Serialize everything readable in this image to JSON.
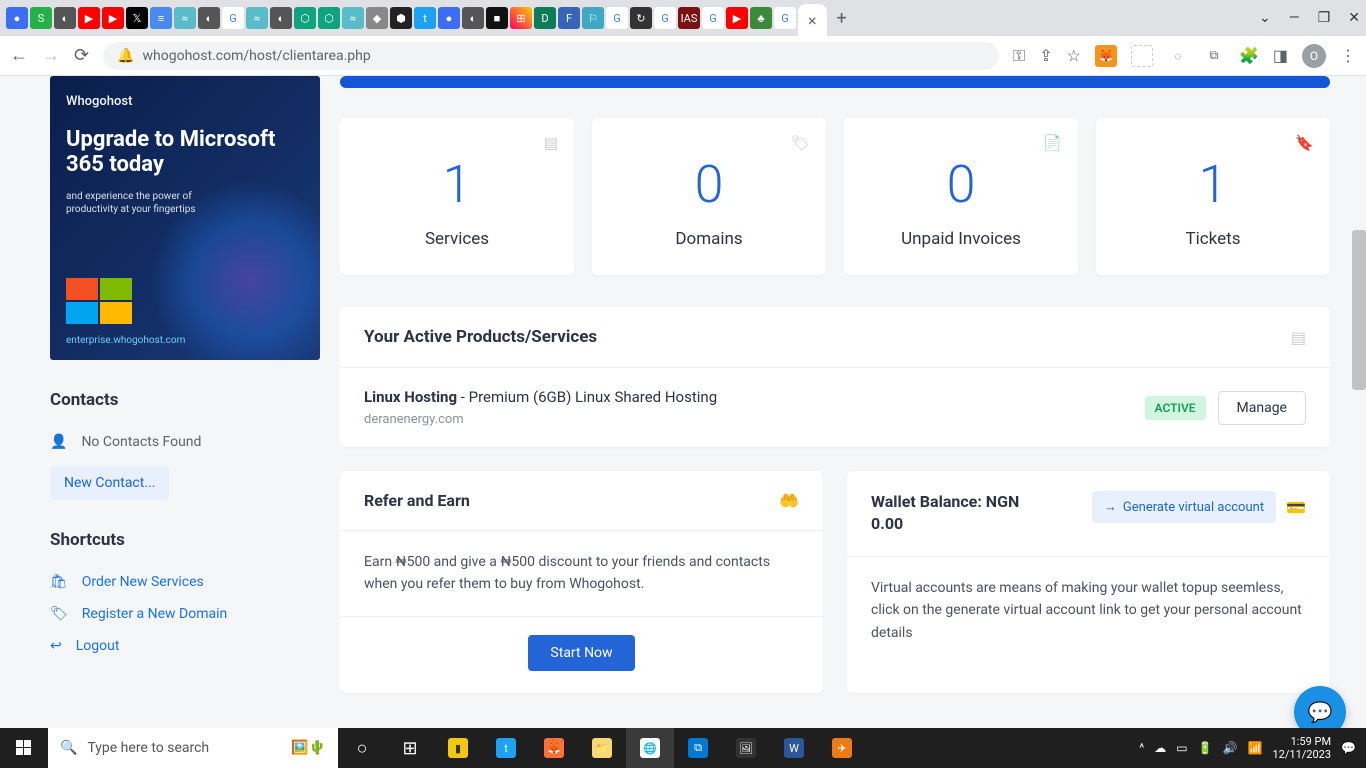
{
  "browser": {
    "url": "whogohost.com/host/clientarea.php",
    "avatar": "O"
  },
  "promo": {
    "brand": "Whogohost",
    "title": "Upgrade to Microsoft 365 today",
    "subtitle": "and experience the power of productivity at your fingertips",
    "link": "enterprise.whogohost.com"
  },
  "sidebar": {
    "contacts_title": "Contacts",
    "no_contacts": "No Contacts Found",
    "new_contact": "New Contact...",
    "shortcuts_title": "Shortcuts",
    "order": "Order New Services",
    "register_domain": "Register a New Domain",
    "logout": "Logout"
  },
  "stats": {
    "services": {
      "value": "1",
      "label": "Services"
    },
    "domains": {
      "value": "0",
      "label": "Domains"
    },
    "invoices": {
      "value": "0",
      "label": "Unpaid Invoices"
    },
    "tickets": {
      "value": "1",
      "label": "Tickets"
    }
  },
  "active_products": {
    "title": "Your Active Products/Services",
    "product_name": "Linux Hosting",
    "product_plan": " - Premium (6GB) Linux Shared Hosting",
    "product_domain": "deranenergy.com",
    "status": "ACTIVE",
    "manage": "Manage"
  },
  "refer": {
    "title": "Refer and Earn",
    "text": "Earn ₦500 and give a ₦500 discount to your friends and contacts when you refer them to buy from Whogohost.",
    "button": "Start Now"
  },
  "wallet": {
    "title": "Wallet Balance: NGN 0.00",
    "gen_button": "Generate virtual account",
    "text": "Virtual accounts are means of making your wallet topup seemless, click on the generate virtual account link to get your personal account details"
  },
  "taskbar": {
    "search_placeholder": "Type here to search",
    "time": "1:59 PM",
    "date": "12/11/2023"
  }
}
